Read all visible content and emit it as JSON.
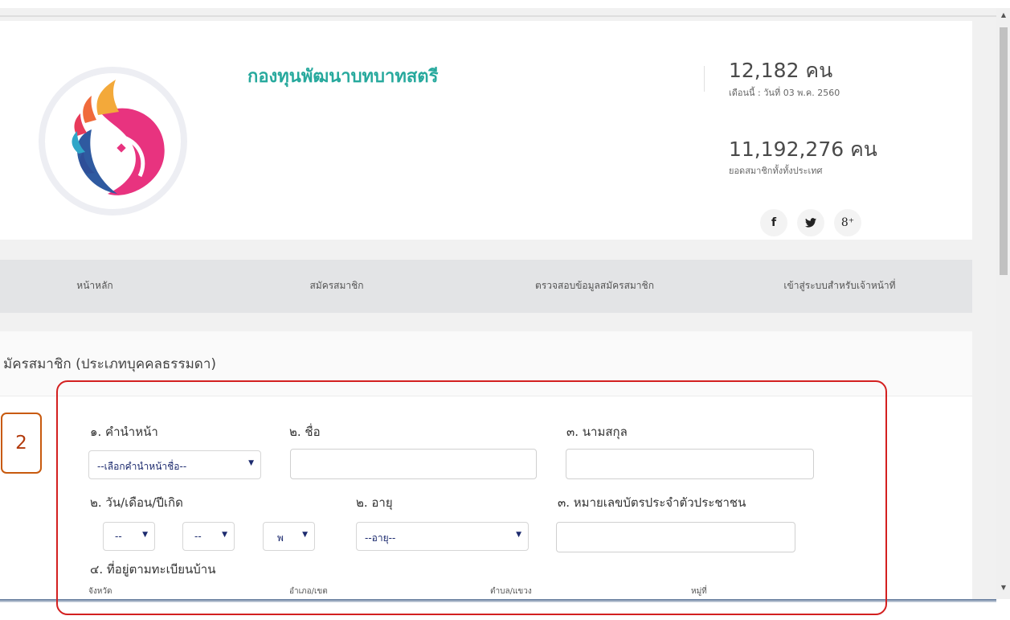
{
  "header": {
    "site_title": "กองทุนพัฒนาบทบาทสตรี",
    "stat_month_count": "12,182 คน",
    "stat_month_label": "เดือนนี้ : วันที่ 03 พ.ค. 2560",
    "stat_total_count": "11,192,276 คน",
    "stat_total_label": "ยอดสมาชิกทั้งทั้งประเทศ",
    "social": {
      "facebook": "f",
      "twitter": "🐦",
      "google_plus": "8⁺"
    }
  },
  "nav": {
    "items": [
      "หน้าหลัก",
      "สมัครสมาชิก",
      "ตรวจสอบข้อมูลสมัครสมาชิก",
      "เข้าสู่ระบบสำหรับเจ้าหน้าที่"
    ]
  },
  "form": {
    "heading": "มัครสมาชิก (ประเภทบุคคลธรรมดา)",
    "labels": {
      "prefix": "๑. คำนำหน้า",
      "first_name": "๒. ชื่อ",
      "last_name": "๓. นามสกุล",
      "birthdate": "๒. วัน/เดือน/ปีเกิด",
      "age": "๒. อายุ",
      "id_card": "๓. หมายเลขบัตรประจำตัวประชาชน",
      "address": "๔. ที่อยู่ตามทะเบียนบ้าน"
    },
    "selects": {
      "prefix": "--เลือกคำนำหน้าชื่อ--",
      "day": "--",
      "month": "--",
      "year": "พ",
      "age": "--อายุ--"
    },
    "address_sub_labels": [
      "จังหวัด",
      "อำเภอ/เขต",
      "ตำบล/แขวง",
      "หมู่ที่"
    ]
  },
  "annotation": {
    "badge": "2"
  },
  "colors": {
    "title_teal": "#27a99d",
    "annotation_red": "#d32020",
    "badge_orange": "#c85a0e"
  }
}
